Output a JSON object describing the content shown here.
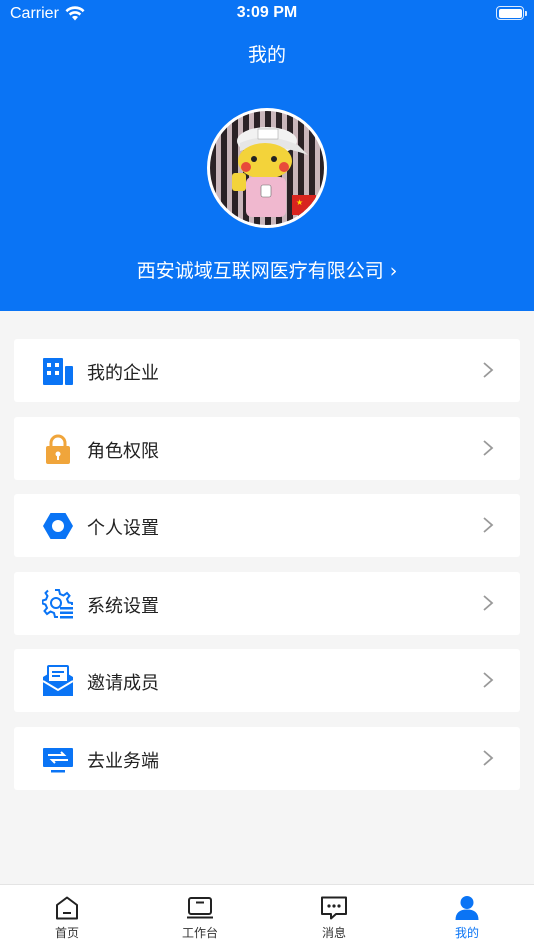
{
  "status_bar": {
    "carrier": "Carrier",
    "time": "3:09 PM"
  },
  "page_title": "我的",
  "company_name": "西安诚域互联网医疗有限公司",
  "menu": [
    {
      "label": "我的企业",
      "icon": "building-icon"
    },
    {
      "label": "角色权限",
      "icon": "lock-icon"
    },
    {
      "label": "个人设置",
      "icon": "hexagon-settings-icon"
    },
    {
      "label": "系统设置",
      "icon": "gear-list-icon"
    },
    {
      "label": "邀请成员",
      "icon": "invite-mail-icon"
    },
    {
      "label": "去业务端",
      "icon": "monitor-switch-icon"
    }
  ],
  "tabs": [
    {
      "label": "首页",
      "icon": "home-icon",
      "active": false
    },
    {
      "label": "工作台",
      "icon": "workbench-icon",
      "active": false
    },
    {
      "label": "消息",
      "icon": "message-icon",
      "active": false
    },
    {
      "label": "我的",
      "icon": "user-icon",
      "active": true
    }
  ],
  "colors": {
    "primary": "#0a74f5",
    "lock": "#f0a53b",
    "background": "#f5f5f5"
  }
}
